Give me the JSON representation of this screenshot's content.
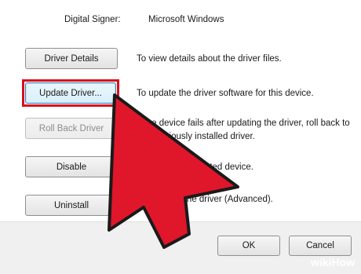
{
  "signer": {
    "label": "Digital Signer:",
    "value": "Microsoft Windows"
  },
  "buttons": {
    "driver_details": "Driver Details",
    "update_driver": "Update Driver...",
    "roll_back": "Roll Back Driver",
    "disable": "Disable",
    "uninstall": "Uninstall",
    "ok": "OK",
    "cancel": "Cancel"
  },
  "descriptions": {
    "driver_details": "To view details about the driver files.",
    "update_driver": "To update the driver software for this device.",
    "roll_back": "If the device fails after updating the driver, roll back to the previously installed driver.",
    "disable": "Disables the selected device.",
    "uninstall": "To uninstall the driver (Advanced)."
  },
  "watermark": {
    "part1": "wiki",
    "part2": "How"
  },
  "colors": {
    "highlight": "#d6111e",
    "arrow": "#e0162b",
    "arrow_outline": "#1a1a1a"
  }
}
